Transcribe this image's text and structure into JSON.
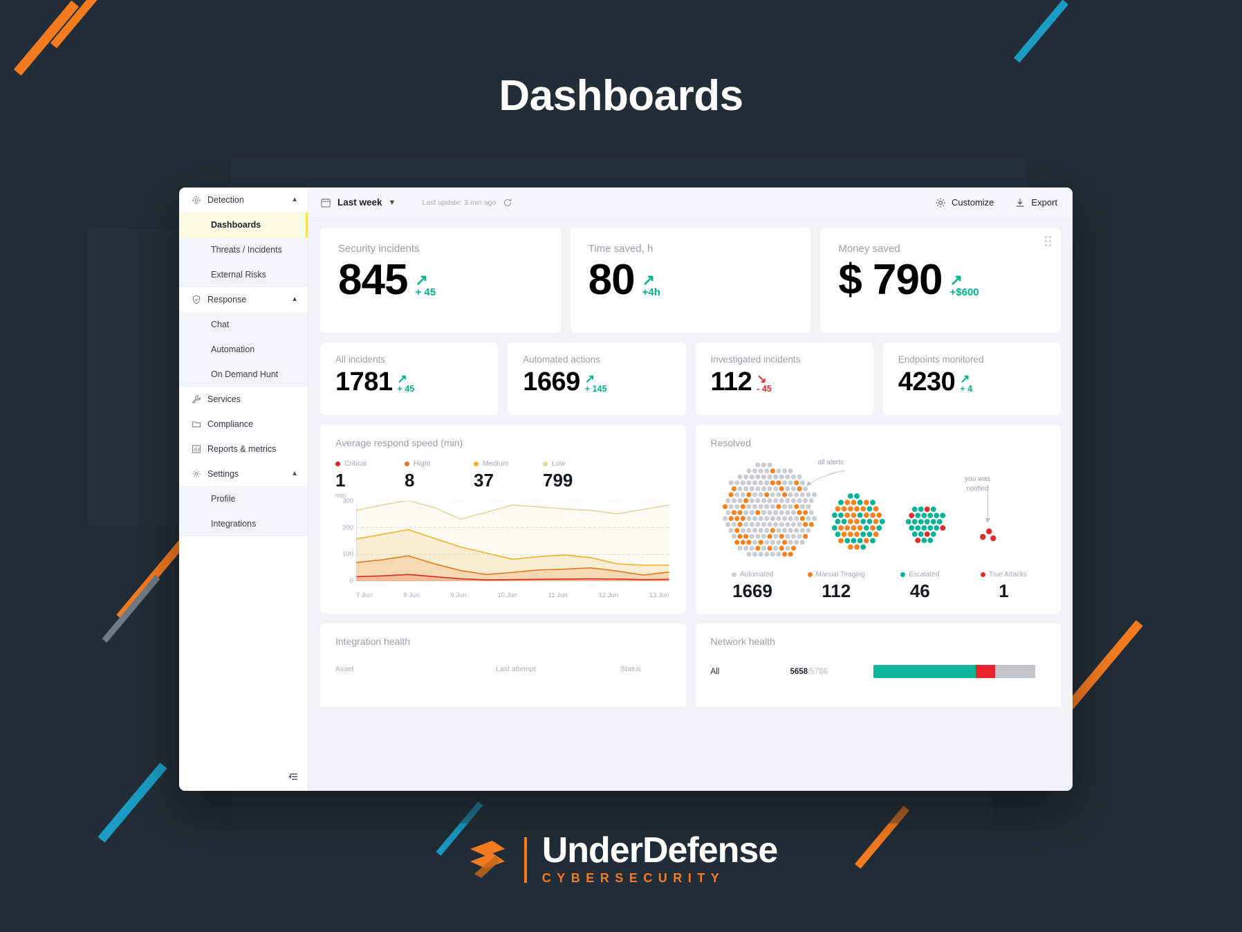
{
  "page": {
    "title": "Dashboards",
    "brand_name": "UnderDefense",
    "brand_sub": "CYBERSECURITY",
    "accent_orange": "#f47b20",
    "accent_teal": "#1b9cc4",
    "bg": "#222d37"
  },
  "sidebar": {
    "groups": [
      {
        "label": "Detection",
        "icon": "target-icon",
        "chevron": "chevron-up-icon",
        "children": [
          {
            "label": "Dashboards",
            "active": true
          },
          {
            "label": "Threats / Incidents",
            "active": false
          },
          {
            "label": "External Risks",
            "active": false
          }
        ]
      },
      {
        "label": "Response",
        "icon": "shield-check-icon",
        "chevron": "chevron-up-icon",
        "children": [
          {
            "label": "Chat",
            "active": false
          },
          {
            "label": "Automation",
            "active": false
          },
          {
            "label": "On Demand Hunt",
            "active": false
          }
        ]
      },
      {
        "label": "Services",
        "icon": "wrench-icon",
        "chevron": "",
        "children": []
      },
      {
        "label": "Compliance",
        "icon": "folder-icon",
        "chevron": "",
        "children": []
      },
      {
        "label": "Reports & metrics",
        "icon": "bar-chart-icon",
        "chevron": "",
        "children": []
      },
      {
        "label": "Settings",
        "icon": "gear-icon",
        "chevron": "chevron-up-icon",
        "children": [
          {
            "label": "Profile",
            "active": false
          },
          {
            "label": "Integrations",
            "active": false
          }
        ]
      }
    ],
    "collapse_icon": "collapse-sidebar-icon"
  },
  "toolbar": {
    "calendar_icon": "calendar-icon",
    "range": "Last week",
    "chevron": "chevron-down-icon",
    "last_update": "Last update: 3 min ago",
    "refresh_icon": "refresh-icon",
    "customize": "Customize",
    "customize_icon": "gear-icon",
    "export": "Export",
    "export_icon": "download-icon"
  },
  "kpi_primary": [
    {
      "title": "Security incidents",
      "value": "845",
      "delta": "+ 45",
      "arrow": "↗",
      "dir": "up"
    },
    {
      "title": "Time saved, h",
      "value": "80",
      "delta": "+4h",
      "arrow": "↗",
      "dir": "up"
    },
    {
      "title": "Money saved",
      "value": "$ 790",
      "delta": "+$600",
      "arrow": "↗",
      "dir": "up"
    }
  ],
  "kpi_secondary": [
    {
      "title": "All incidents",
      "value": "1781",
      "delta": "+ 45",
      "arrow": "↗",
      "dir": "up"
    },
    {
      "title": "Automated actions",
      "value": "1669",
      "delta": "+ 145",
      "arrow": "↗",
      "dir": "up"
    },
    {
      "title": "Investigated incidents",
      "value": "112",
      "delta": "- 45",
      "arrow": "↘",
      "dir": "down"
    },
    {
      "title": "Endpoints monitored",
      "value": "4230",
      "delta": "+ 4",
      "arrow": "↗",
      "dir": "up"
    }
  ],
  "respond_speed": {
    "title": "Average respond speed (min)"
  },
  "resolved": {
    "title": "Resolved",
    "annotation_all_alerts": "all alerts",
    "annotation_notified_line1": "you was",
    "annotation_notified_line2": "notified",
    "legend": [
      {
        "label": "Automated",
        "value": "1669",
        "color": "#c9ced3"
      },
      {
        "label": "Manual Tiraging",
        "value": "112",
        "color": "#f58220"
      },
      {
        "label": "Escalated",
        "value": "46",
        "color": "#00b396"
      },
      {
        "label": "True Attacks",
        "value": "1",
        "color": "#e02b2b"
      }
    ]
  },
  "integration_health": {
    "title": "Integration health",
    "columns": [
      "Asset",
      "Last attempt",
      "Status"
    ]
  },
  "network_health": {
    "title": "Network health",
    "rows": [
      {
        "name": "All",
        "ok": "5658",
        "total": "5786",
        "ok_pct": 63,
        "fail_pct": 12,
        "idle_pct": 25
      }
    ]
  },
  "chart_data": {
    "type": "area",
    "title": "Average respond speed (min)",
    "xlabel": "",
    "ylabel": "min",
    "ylim": [
      0,
      300
    ],
    "yticks": [
      0,
      100,
      200,
      300
    ],
    "grid": true,
    "legend_position": "top",
    "categories": [
      "7 Jun",
      "8 Jun",
      "9 Jun",
      "10 Jun",
      "11 Jun",
      "12 Jun",
      "13 Jun"
    ],
    "x": [
      0,
      0.5,
      1,
      1.5,
      2,
      2.5,
      3,
      3.5,
      4,
      4.5,
      5,
      5.5,
      6
    ],
    "series": [
      {
        "name": "Critical",
        "color": "#d62828",
        "summary": 1,
        "values": [
          17,
          20,
          25,
          17,
          9,
          5,
          6,
          7,
          8,
          9,
          8,
          6,
          7
        ]
      },
      {
        "name": "Hight",
        "color": "#e8781a",
        "summary": 8,
        "values": [
          70,
          80,
          95,
          65,
          40,
          25,
          33,
          42,
          45,
          50,
          38,
          23,
          34
        ]
      },
      {
        "name": "Medium",
        "color": "#f0b429",
        "summary": 37,
        "values": [
          158,
          175,
          193,
          160,
          128,
          105,
          82,
          92,
          98,
          88,
          65,
          60,
          60
        ]
      },
      {
        "name": "Low",
        "color": "#dfd9a0",
        "summary": 799,
        "values": [
          265,
          285,
          302,
          275,
          232,
          258,
          285,
          278,
          270,
          265,
          252,
          268,
          285
        ]
      }
    ]
  }
}
